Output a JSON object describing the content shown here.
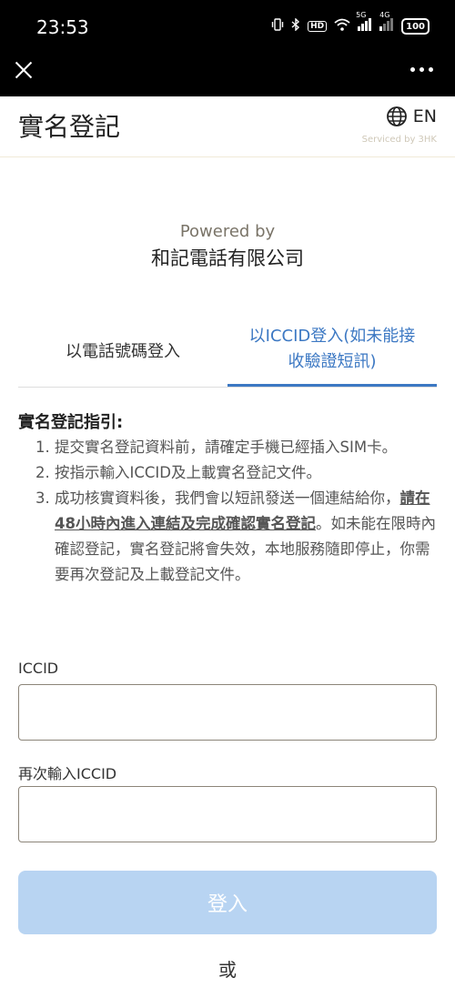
{
  "status_bar": {
    "time": "23:53",
    "network_5g": "5G",
    "network_4g": "4G",
    "hd_badge": "HD",
    "battery": "100"
  },
  "toolbar": {
    "close_icon": "close-icon",
    "more_icon": "more-icon"
  },
  "header": {
    "title": "實名登記",
    "language": "EN",
    "serviced_by": "Serviced by 3HK"
  },
  "powered": {
    "label": "Powered by",
    "company": "和記電話有限公司"
  },
  "tabs": [
    {
      "label": "以電話號碼登入",
      "active": false
    },
    {
      "label": "以ICCID登入(如未能接收驗證短訊)",
      "active": true
    }
  ],
  "guide": {
    "title": "實名登記指引:",
    "items": [
      "提交實名登記資料前，請確定手機已經插入SIM卡。",
      "按指示輸入ICCID及上載實名登記文件。"
    ],
    "item3_prefix": "成功核實資料後，我們會以短訊發送一個連結給你，",
    "item3_emphasis": "請在48小時內進入連結及完成確認實名登記",
    "item3_suffix": "。如未能在限時內確認登記，實名登記將會失效，本地服務隨即停止，你需要再次登記及上載登記文件。"
  },
  "form": {
    "iccid_label": "ICCID",
    "iccid_value": "",
    "iccid_confirm_label": "再次輸入ICCID",
    "iccid_confirm_value": ""
  },
  "login_button": "登入",
  "or_text": "或",
  "colors": {
    "accent": "#3c78c3",
    "button_disabled": "#b8d4f2"
  }
}
